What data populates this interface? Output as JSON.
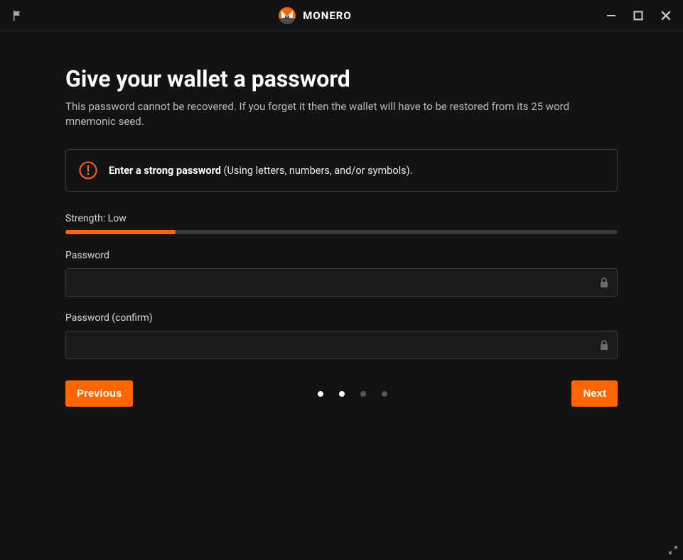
{
  "brand": "MONERO",
  "colors": {
    "accent": "#ff6600",
    "bg": "#131313"
  },
  "page": {
    "title": "Give your wallet a password",
    "subtitle": "This password cannot be recovered. If you forget it then the wallet will have to be restored from its 25 word mnemonic seed."
  },
  "info": {
    "bold": "Enter a strong password",
    "rest": " (Using letters, numbers, and/or symbols)."
  },
  "strength": {
    "label": "Strength: Low",
    "percent": 20
  },
  "fields": {
    "password_label": "Password",
    "password_value": "",
    "confirm_label": "Password (confirm)",
    "confirm_value": ""
  },
  "nav": {
    "previous": "Previous",
    "next": "Next",
    "steps_total": 4,
    "steps_filled": 2
  }
}
